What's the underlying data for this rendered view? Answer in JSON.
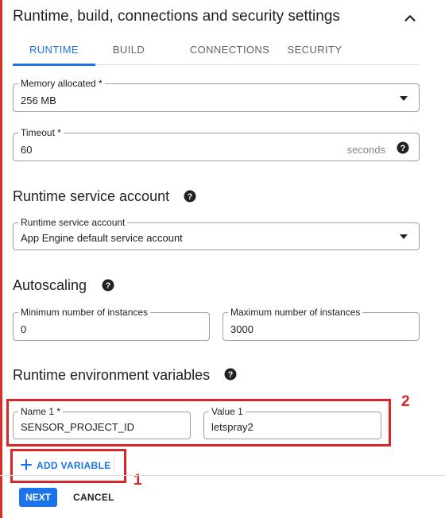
{
  "header": {
    "title": "Runtime, build, connections and security settings",
    "collapse_icon": "chevron-up-icon"
  },
  "tabs": [
    {
      "label": "RUNTIME",
      "active": true
    },
    {
      "label": "BUILD",
      "active": false
    },
    {
      "label": "CONNECTIONS",
      "active": false
    },
    {
      "label": "SECURITY",
      "active": false
    }
  ],
  "runtime": {
    "memory": {
      "label": "Memory allocated *",
      "value": "256 MB"
    },
    "timeout": {
      "label": "Timeout *",
      "value": "60",
      "suffix": "seconds"
    }
  },
  "service_account": {
    "title": "Runtime service account",
    "field_label": "Runtime service account",
    "value": "App Engine default service account"
  },
  "autoscaling": {
    "title": "Autoscaling",
    "min": {
      "label": "Minimum number of instances",
      "value": "0"
    },
    "max": {
      "label": "Maximum number of instances",
      "value": "3000"
    }
  },
  "env_vars": {
    "title": "Runtime environment variables",
    "name": {
      "label": "Name 1 *",
      "value": "SENSOR_PROJECT_ID"
    },
    "value": {
      "label": "Value 1",
      "value": "letspray2"
    },
    "add_label": "ADD VARIABLE"
  },
  "annotations": {
    "box1_number": "1",
    "box2_number": "2"
  },
  "footer": {
    "next_label": "NEXT",
    "cancel_label": "CANCEL"
  },
  "colors": {
    "accent": "#1a73e8",
    "annotation_red": "#d9252a",
    "left_bar": "#d93025"
  }
}
